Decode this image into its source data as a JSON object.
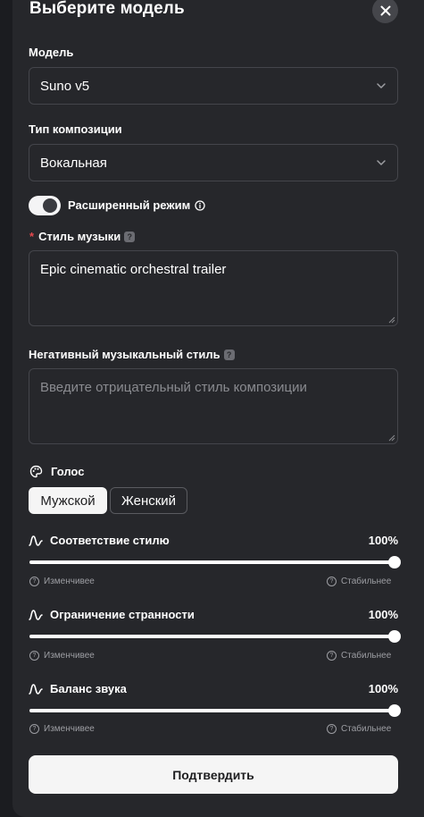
{
  "dialog": {
    "title": "Выберите модель"
  },
  "model": {
    "label": "Модель",
    "value": "Suno v5"
  },
  "composition": {
    "label": "Тип композиции",
    "value": "Вокальная"
  },
  "advanced": {
    "label": "Расширенный режим",
    "enabled": true
  },
  "style": {
    "required_mark": "*",
    "label": "Стиль музыки",
    "value": "Epic cinematic orchestral trailer"
  },
  "negative_style": {
    "label": "Негативный музыкальный стиль",
    "placeholder": "Введите отрицательный стиль композиции",
    "value": ""
  },
  "voice": {
    "label": "Голос",
    "options": [
      "Мужской",
      "Женский"
    ],
    "selected": "Мужской"
  },
  "sliders": [
    {
      "label": "Соответствие стилю",
      "value_text": "100%",
      "value": 1.0,
      "left_hint": "Изменчивее",
      "right_hint": "Стабильнее"
    },
    {
      "label": "Ограничение странности",
      "value_text": "100%",
      "value": 1.0,
      "left_hint": "Изменчивее",
      "right_hint": "Стабильнее"
    },
    {
      "label": "Баланс звука",
      "value_text": "100%",
      "value": 1.0,
      "left_hint": "Изменчивее",
      "right_hint": "Стабильнее"
    }
  ],
  "confirm_label": "Подтвердить",
  "colors": {
    "panel": "#26272b",
    "background": "#1b1c20",
    "accent_light": "#f5f5f5",
    "required": "#e5484d"
  }
}
